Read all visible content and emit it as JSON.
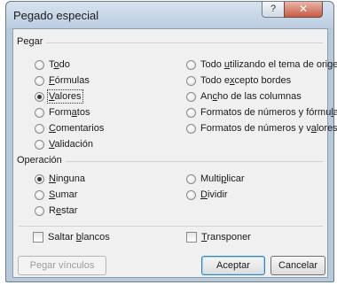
{
  "dialog": {
    "title": "Pegado especial",
    "help_label": "?",
    "close_label": "✕"
  },
  "paste": {
    "label": "Pegar",
    "left": [
      {
        "pre": "T",
        "key": "o",
        "post": "do",
        "selected": false
      },
      {
        "pre": "",
        "key": "F",
        "post": "órmulas",
        "selected": false
      },
      {
        "pre": "",
        "key": "V",
        "post": "alores",
        "selected": true
      },
      {
        "pre": "Form",
        "key": "a",
        "post": "tos",
        "selected": false
      },
      {
        "pre": "",
        "key": "C",
        "post": "omentarios",
        "selected": false
      },
      {
        "pre": "",
        "key": "V",
        "post": "alidación",
        "selected": false
      }
    ],
    "right": [
      {
        "pre": "Todo ",
        "key": "u",
        "post": "tilizando el tema de origen",
        "selected": false
      },
      {
        "pre": "Todo e",
        "key": "x",
        "post": "cepto bordes",
        "selected": false
      },
      {
        "pre": "An",
        "key": "c",
        "post": "ho de las columnas",
        "selected": false
      },
      {
        "pre": "Formatos de números y fórmu",
        "key": "l",
        "post": "as",
        "selected": false
      },
      {
        "pre": "Formatos de números y v",
        "key": "a",
        "post": "lores",
        "selected": false
      }
    ]
  },
  "operation": {
    "label": "Operación",
    "left": [
      {
        "pre": "",
        "key": "N",
        "post": "inguna",
        "selected": true
      },
      {
        "pre": "",
        "key": "S",
        "post": "umar",
        "selected": false
      },
      {
        "pre": "R",
        "key": "e",
        "post": "star",
        "selected": false
      }
    ],
    "right": [
      {
        "pre": "Multi",
        "key": "p",
        "post": "licar",
        "selected": false
      },
      {
        "pre": "",
        "key": "D",
        "post": "ividir",
        "selected": false
      }
    ]
  },
  "checks": [
    {
      "pre": "Saltar ",
      "key": "b",
      "post": "lancos",
      "checked": false
    },
    {
      "pre": "",
      "key": "T",
      "post": "ransponer",
      "checked": false
    }
  ],
  "buttons": {
    "paste_link": "Pegar vínculos",
    "accept": "Aceptar",
    "cancel": "Cancelar"
  }
}
